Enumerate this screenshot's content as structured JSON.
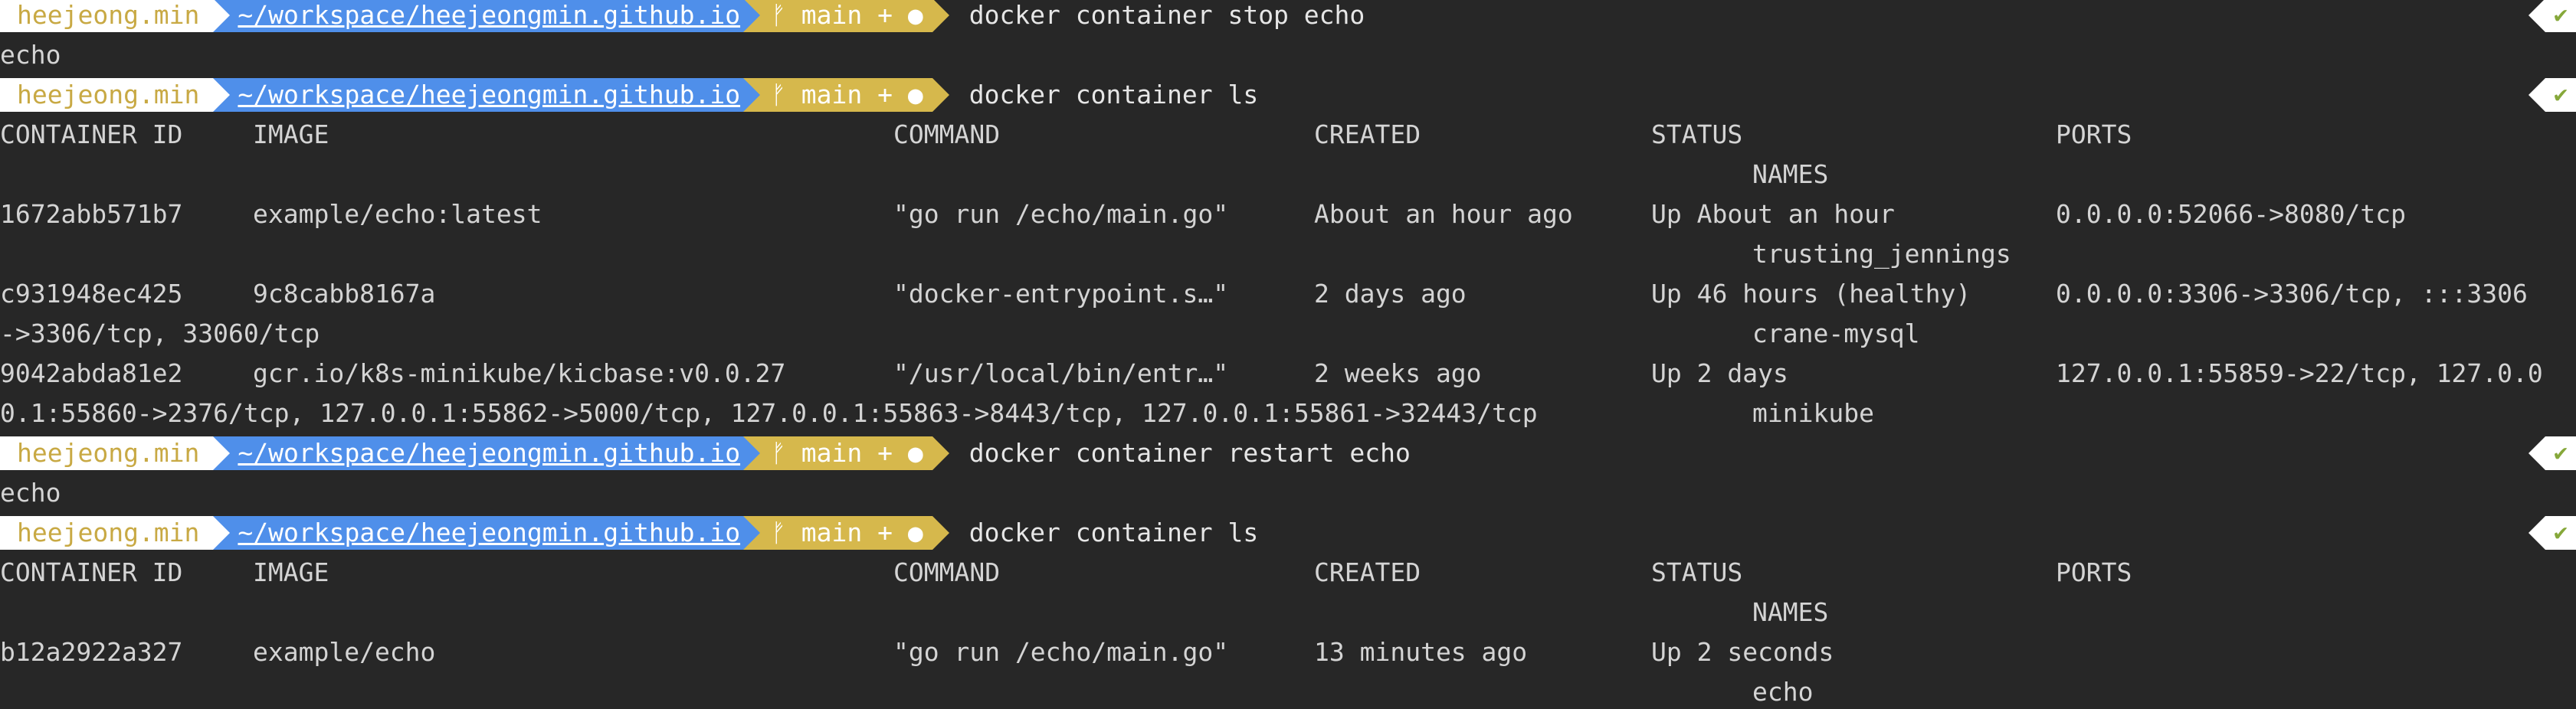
{
  "prompt": {
    "user": "heejeong.min",
    "path": "~/workspace/heejeongmin.github.io",
    "git_icon": "git-branch-icon",
    "branch": "main + ●",
    "status_check": "✔"
  },
  "commands": [
    "docker container stop echo",
    "docker container ls",
    "docker container restart echo",
    "docker container ls"
  ],
  "outputs": {
    "stop": "echo",
    "restart": "echo"
  },
  "table_headers": {
    "container_id": "CONTAINER ID",
    "image": "IMAGE",
    "command": "COMMAND",
    "created": "CREATED",
    "status": "STATUS",
    "ports": "PORTS",
    "names": "NAMES"
  },
  "ls1_rows": [
    {
      "id": "1672abb571b7",
      "image": "example/echo:latest",
      "command": "\"go run /echo/main.go\"",
      "created": "About an hour ago",
      "status": "Up About an hour",
      "ports": "0.0.0.0:52066->8080/tcp",
      "ports_cont": "",
      "names": "trusting_jennings"
    },
    {
      "id": "c931948ec425",
      "image": "9c8cabb8167a",
      "command": "\"docker-entrypoint.s…\"",
      "created": "2 days ago",
      "status": "Up 46 hours (healthy)",
      "ports": "0.0.0.0:3306->3306/tcp, :::3306",
      "ports_cont": "->3306/tcp, 33060/tcp",
      "names": "crane-mysql"
    },
    {
      "id": "9042abda81e2",
      "image": "gcr.io/k8s-minikube/kicbase:v0.0.27",
      "command": "\"/usr/local/bin/entr…\"",
      "created": "2 weeks ago",
      "status": "Up 2 days",
      "ports": "127.0.0.1:55859->22/tcp, 127.0.0",
      "ports_cont": "0.1:55860->2376/tcp, 127.0.0.1:55862->5000/tcp, 127.0.0.1:55863->8443/tcp, 127.0.0.1:55861->32443/tcp",
      "names": "minikube"
    }
  ],
  "ls2_rows": [
    {
      "id": "b12a2922a327",
      "image": "example/echo",
      "command": "\"go run /echo/main.go\"",
      "created": "13 minutes ago",
      "status": "Up 2 seconds",
      "ports": "",
      "names": "echo"
    }
  ]
}
